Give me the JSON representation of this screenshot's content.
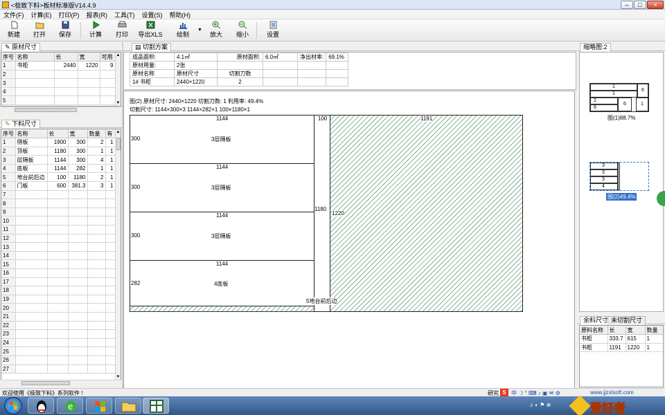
{
  "window": {
    "title": "<极致下料>板材标准版V14.4.9",
    "min": "–",
    "max": "□",
    "close": "×"
  },
  "menu": [
    "文件(F)",
    "计算(E)",
    "打印(P)",
    "报表(R)",
    "工具(T)",
    "设置(S)",
    "帮助(H)"
  ],
  "toolbar": [
    {
      "label": "新建",
      "icon": "new-file-icon"
    },
    {
      "label": "打开",
      "icon": "open-folder-icon"
    },
    {
      "label": "保存",
      "icon": "save-disk-icon"
    },
    {
      "label": "计算",
      "icon": "play-icon"
    },
    {
      "label": "打印",
      "icon": "printer-icon"
    },
    {
      "label": "导出XLS",
      "icon": "excel-icon"
    },
    {
      "label": "绘制",
      "icon": "chart-icon"
    },
    {
      "label": "放大",
      "icon": "zoom-in-icon"
    },
    {
      "label": "缩小",
      "icon": "zoom-out-icon"
    },
    {
      "label": "设置",
      "icon": "settings-icon"
    }
  ],
  "raw_panel": {
    "tab": "原材尺寸",
    "headers": [
      "序号",
      "名称",
      "长",
      "宽",
      "可用"
    ],
    "rows": [
      [
        "1",
        "书柜",
        "2440",
        "1220",
        "9"
      ],
      [
        "2",
        "",
        "",
        "",
        ""
      ],
      [
        "3",
        "",
        "",
        "",
        ""
      ],
      [
        "4",
        "",
        "",
        "",
        ""
      ],
      [
        "5",
        "",
        "",
        "",
        ""
      ]
    ]
  },
  "cut_panel": {
    "tab": "下料尺寸",
    "headers": [
      "序号",
      "名称",
      "长",
      "宽",
      "数量",
      "有"
    ],
    "rows": [
      [
        "1",
        "侧板",
        "1900",
        "300",
        "2",
        "1"
      ],
      [
        "2",
        "顶板",
        "1180",
        "300",
        "1",
        "1"
      ],
      [
        "3",
        "层隔板",
        "1144",
        "300",
        "4",
        "1"
      ],
      [
        "4",
        "底板",
        "1144",
        "282",
        "1",
        "1"
      ],
      [
        "5",
        "地台前后边",
        "100",
        "1180",
        "2",
        "1"
      ],
      [
        "6",
        "门板",
        "600",
        "381.3",
        "3",
        "1"
      ],
      [
        "7"
      ],
      [
        "8"
      ],
      [
        "9"
      ],
      [
        "10"
      ],
      [
        "11"
      ],
      [
        "12"
      ],
      [
        "13"
      ],
      [
        "14"
      ],
      [
        "15"
      ],
      [
        "16"
      ],
      [
        "17"
      ],
      [
        "18"
      ],
      [
        "19"
      ],
      [
        "20"
      ],
      [
        "21"
      ],
      [
        "22"
      ],
      [
        "23"
      ],
      [
        "24"
      ],
      [
        "25"
      ],
      [
        "26"
      ],
      [
        "27"
      ]
    ]
  },
  "plan_tab": "切割方案",
  "summary": {
    "finished_area_label": "成品面积:",
    "finished_area": "4.1㎡",
    "raw_area_label": "原材面积:",
    "raw_area": "6.0㎡",
    "net_rate_label": "净出材率:",
    "net_rate": "69.1%",
    "raw_usage_label": "原材用量:",
    "raw_usage": "2张",
    "col_name": "原材名称",
    "col_size": "原材尺寸",
    "col_cuts": "切割刀数",
    "row_name": "1# 书柜",
    "row_size": "2440×1220",
    "row_cuts": "2"
  },
  "drawing": {
    "header1": "图(2) 原材尺寸: 2440×1220  切割刀数: 1  利用率: 49.4%",
    "header2": "切割尺寸: 1144×300×3  1144×282×1  100×1180×1",
    "pieces": [
      {
        "top": "1144",
        "left": "300",
        "name": "3层隔板"
      },
      {
        "top": "1144",
        "left": "300",
        "name": "3层隔板"
      },
      {
        "top": "1144",
        "left": "300",
        "name": "3层隔板"
      },
      {
        "top": "1144",
        "left": "282",
        "name": "4底板"
      }
    ],
    "strip_top": "100",
    "strip_side": "1180",
    "strip_label": "5地台前后边",
    "waste_top": "1191",
    "waste_side": "1220"
  },
  "thumbnails": {
    "tab": "缩略图:2",
    "t1_label": "图(1)88.7%",
    "t1_cells": [
      "1",
      "1",
      "1",
      "6",
      "2",
      "6",
      "3",
      "6"
    ],
    "t2_label": "图(2)49.4%",
    "t2_cells": [
      "3",
      "3",
      "3",
      "4"
    ]
  },
  "remnant": {
    "tabs": [
      "余料尺寸",
      "未切割尺寸"
    ],
    "headers": [
      "原料名称",
      "长",
      "宽",
      "数量"
    ],
    "rows": [
      [
        "书柜",
        "333.7",
        "615",
        "1"
      ],
      [
        "书柜",
        "1191",
        "1220",
        "1"
      ]
    ]
  },
  "status": "欢迎使用《极致下料》系列软件 !",
  "taskbar": {
    "tray_text": "研究",
    "website": "www.jjzxlsoft.com",
    "brand": "爱好者"
  },
  "colors": {
    "waste_hatch": "#2e7d4a",
    "selection": "#3070c8"
  }
}
